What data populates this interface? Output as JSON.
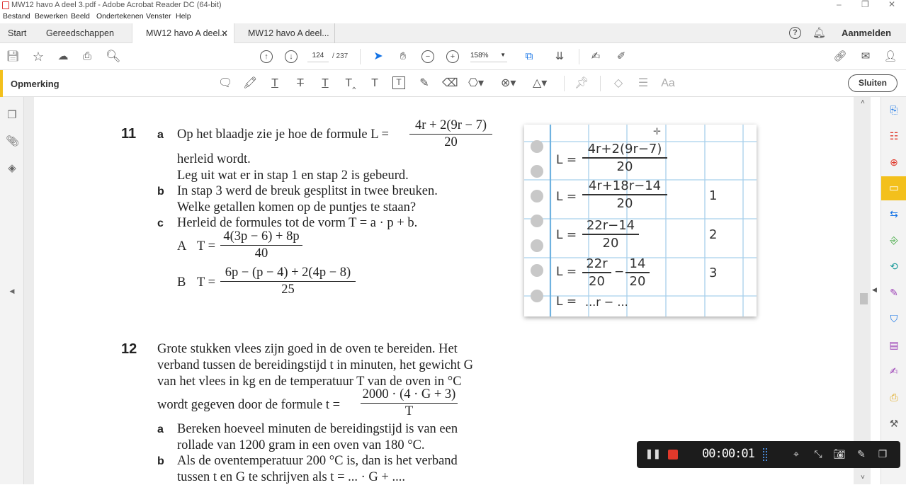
{
  "window": {
    "title": "MW12 havo A deel 3.pdf - Adobe Acrobat Reader DC (64-bit)"
  },
  "menu": [
    "Bestand",
    "Bewerken",
    "Beeld",
    "Ondertekenen",
    "Venster",
    "Help"
  ],
  "tabs": {
    "start": "Start",
    "tools": "Gereedschappen",
    "doc1": "MW12 havo A deel...",
    "doc2": "MW12 havo A deel..."
  },
  "header": {
    "signin": "Aanmelden"
  },
  "toolbar": {
    "page_current": "124",
    "page_total": "/ 237",
    "zoom": "158%"
  },
  "annotbar": {
    "title": "Opmerking",
    "close": "Sluiten"
  },
  "q11": {
    "num": "11",
    "a_label": "a",
    "a_line1": "Op het blaadje zie je hoe de formule L =",
    "a_frac_num": "4r + 2(9r − 7)",
    "a_frac_den": "20",
    "a_line2": "herleid wordt.",
    "a_line3": "Leg uit wat er in stap 1 en stap 2 is gebeurd.",
    "b_label": "b",
    "b_line1": "In stap 3 werd de breuk gesplitst in twee breuken.",
    "b_line2": "Welke getallen komen op de puntjes te staan?",
    "c_label": "c",
    "c_line1": "Herleid de formules tot de vorm T = a · p + b.",
    "cA_label": "A",
    "cA_eq": "T =",
    "cA_num": "4(3p − 6) + 8p",
    "cA_den": "40",
    "cB_label": "B",
    "cB_eq": "T =",
    "cB_num": "6p − (p − 4) + 2(4p − 8)",
    "cB_den": "25"
  },
  "notebook": {
    "row1_eq": "L =",
    "row1_num": "4r+2(9r−7)",
    "row1_den": "20",
    "row2_eq": "L =",
    "row2_num": "4r+18r−14",
    "row2_den": "20",
    "row2_step": "1",
    "row3_eq": "L =",
    "row3_num": "22r−14",
    "row3_den": "20",
    "row3_step": "2",
    "row4_eq": "L =",
    "row4_n1": "22r",
    "row4_d1": "20",
    "row4_minus": "−",
    "row4_n2": "14",
    "row4_d2": "20",
    "row4_step": "3",
    "row5_eq": "L =",
    "row5_rest": "...r − ..."
  },
  "q12": {
    "num": "12",
    "line1": "Grote stukken vlees zijn goed in de oven te bereiden. Het",
    "line2": "verband tussen de bereidingstijd t in minuten, het gewicht G",
    "line3": "van het vlees in kg en de temperatuur T van de oven in °C",
    "line4": "wordt gegeven door de formule t =",
    "frac_num": "2000 · (4 · G + 3)",
    "frac_den": "T",
    "a_label": "a",
    "a_line1": "Bereken hoeveel minuten de bereidingstijd is van een",
    "a_line2": "rollade van 1200 gram in een oven van 180 °C.",
    "b_label": "b",
    "b_line1": "Als de oventemperatuur 200 °C is, dan is het verband",
    "b_line2": "tussen t en G te schrijven als t = ... · G + ...."
  },
  "recorder": {
    "timer": "00:00:01"
  },
  "colors": {
    "accent": "#f3c01c",
    "grid": "#a8d0ec",
    "record": "#e0392b",
    "blue_tool": "#1473e6"
  }
}
